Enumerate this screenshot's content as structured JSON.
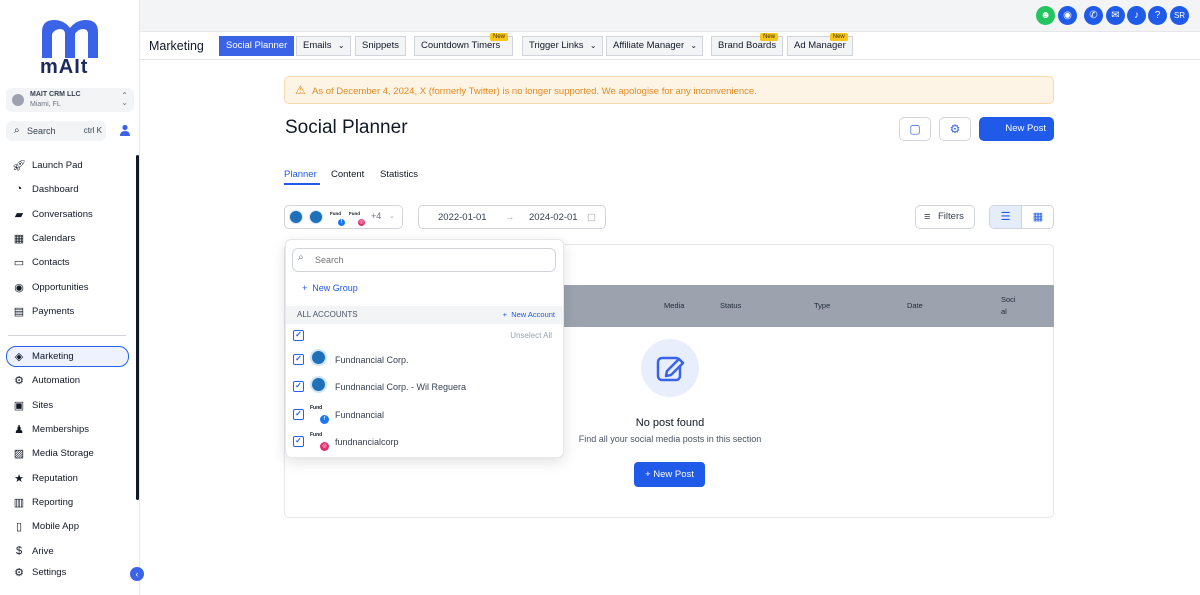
{
  "sidebar": {
    "logo_text": "mAIt",
    "account": {
      "name": "MAIT CRM LLC",
      "location": "Miami, FL"
    },
    "search": {
      "label": "Search",
      "shortcut": "ctrl K"
    },
    "nav_primary": [
      {
        "label": "Launch Pad",
        "icon": "rocket-icon"
      },
      {
        "label": "Dashboard",
        "icon": "gauge-icon"
      },
      {
        "label": "Conversations",
        "icon": "chat-icon"
      },
      {
        "label": "Calendars",
        "icon": "calendar-icon"
      },
      {
        "label": "Contacts",
        "icon": "contact-card-icon"
      },
      {
        "label": "Opportunities",
        "icon": "target-icon"
      },
      {
        "label": "Payments",
        "icon": "wallet-icon"
      }
    ],
    "nav_secondary": [
      {
        "label": "Marketing",
        "icon": "megaphone-icon",
        "active": true
      },
      {
        "label": "Automation",
        "icon": "gear-flow-icon"
      },
      {
        "label": "Sites",
        "icon": "code-window-icon"
      },
      {
        "label": "Memberships",
        "icon": "users-icon"
      },
      {
        "label": "Media Storage",
        "icon": "image-icon"
      },
      {
        "label": "Reputation",
        "icon": "star-icon"
      },
      {
        "label": "Reporting",
        "icon": "chart-icon"
      },
      {
        "label": "Mobile App",
        "icon": "phone-icon"
      },
      {
        "label": "Arive",
        "icon": "dollar-icon"
      },
      {
        "label": "Settings",
        "icon": "gear-icon"
      }
    ]
  },
  "topbar": {
    "icons": [
      {
        "name": "ai-assistant-icon",
        "color": "#22c55e",
        "glyph": "☻"
      },
      {
        "name": "eye-icon",
        "color": "#1f5ae8",
        "glyph": "◉"
      },
      {
        "name": "phone-call-icon",
        "color": "#1f5ae8",
        "glyph": "✆"
      },
      {
        "name": "announcement-icon",
        "color": "#1f5ae8",
        "glyph": "✉"
      },
      {
        "name": "bell-icon",
        "color": "#1f5ae8",
        "glyph": "♪"
      },
      {
        "name": "help-icon",
        "color": "#1f5ae8",
        "glyph": "?"
      },
      {
        "name": "user-avatar-icon",
        "color": "#1f5ae8",
        "glyph": "SR"
      }
    ]
  },
  "subnav": {
    "title": "Marketing",
    "tabs": [
      {
        "label": "Social Planner",
        "active": true
      },
      {
        "label": "Emails",
        "dropdown": true
      },
      {
        "label": "Snippets"
      },
      {
        "label": "Countdown Timers",
        "badge": "New"
      },
      {
        "label": "Trigger Links",
        "dropdown": true
      },
      {
        "label": "Affiliate Manager",
        "dropdown": true
      },
      {
        "label": "Brand Boards",
        "badge": "New"
      },
      {
        "label": "Ad Manager",
        "badge": "New"
      }
    ]
  },
  "banner": {
    "text": "As of December 4, 2024, X (formerly Twitter) is no longer supported. We apologise for any inconvenience."
  },
  "page": {
    "title": "Social Planner",
    "new_post_label": "New Post",
    "tabs": [
      "Planner",
      "Content",
      "Statistics"
    ],
    "accounts_more": "+4",
    "date_from": "2022-01-01",
    "date_to": "2024-02-01",
    "filters_label": "Filters"
  },
  "table": {
    "headers": [
      "Media",
      "Status",
      "Type",
      "Date",
      "Soci",
      "al"
    ],
    "empty_title": "No post found",
    "empty_subtitle": "Find all your social media posts in this section",
    "empty_button": "New Post"
  },
  "dropdown": {
    "search_placeholder": "Search",
    "new_group_label": "New Group",
    "all_accounts_label": "ALL ACCOUNTS",
    "new_account_label": "New Account",
    "unselect_all_label": "Unselect All",
    "accounts": [
      {
        "name": "Fundnancial Corp.",
        "platform": "google-business"
      },
      {
        "name": "Fundnancial Corp. - Wil Reguera",
        "platform": "google-business"
      },
      {
        "name": "Fundnancial",
        "platform": "facebook",
        "brand": "Fund"
      },
      {
        "name": "fundnancialcorp",
        "platform": "instagram",
        "brand": "Fund"
      }
    ]
  },
  "colors": {
    "accent": "#1f5ae8",
    "warning": "#e38a1f",
    "badge": "#f5c518"
  }
}
